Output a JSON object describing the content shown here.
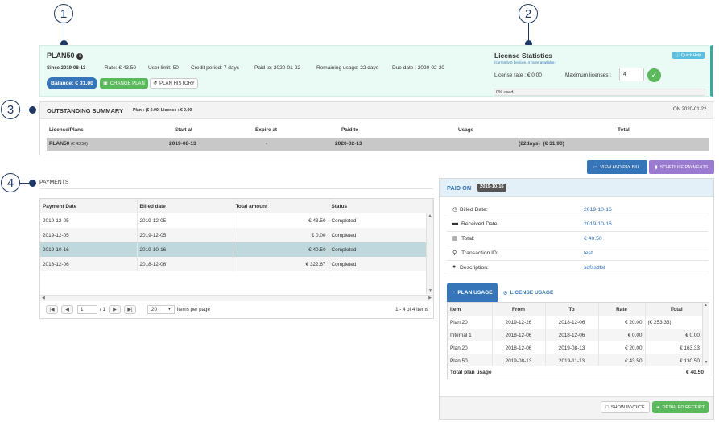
{
  "callouts": [
    "1",
    "2",
    "3",
    "4"
  ],
  "plan": {
    "name": "PLAN50",
    "since": "Since 2019-08-13",
    "rate": "Rate: € 43.50",
    "user_limit": "User limit: 50",
    "credit_period": "Credit period: 7 days",
    "paid_to": "Paid to: 2020-01-22",
    "remaining_usage": "Remaining usage: 22 days",
    "due_date": "Due date : 2020-02-20",
    "balance": "Balance: € 31.00",
    "change_plan": "CHANGE PLAN",
    "plan_history": "PLAN HISTORY"
  },
  "license": {
    "title": "License Statistics",
    "subtitle": "(currently 0 devices, 4 more available.)",
    "quick_help": "Quick Help",
    "rate": "License rate : € 0.00",
    "max_label": "Maximum licenses :",
    "max_value": "4",
    "used": "0% used"
  },
  "summary": {
    "title": "OUTSTANDING SUMMARY",
    "sub": "Plan : (€ 0.00)   License : € 0.00",
    "on": "ON 2020-01-22",
    "headers": [
      "License/Plans",
      "Start at",
      "Expire at",
      "Paid to",
      "Usage",
      "Total"
    ],
    "row": {
      "plan": "PLAN50",
      "plan_rate": "(€ 43.50)",
      "start": "2019-08-13",
      "expire": "-",
      "paid": "2020-02-13",
      "usage_days": "(22days)",
      "usage_amount": "(€ 31.90)"
    }
  },
  "actions": {
    "view_pay": "VIEW AND PAY BILL",
    "schedule": "SCHEDULE PAYMENTS"
  },
  "payments": {
    "title": "PAYMENTS",
    "headers": [
      "Payment Date",
      "Billed date",
      "Total amount",
      "Status"
    ],
    "rows": [
      [
        "2019-12-05",
        "2019-12-05",
        "€ 43.50",
        "Completed"
      ],
      [
        "2019-12-05",
        "2019-12-05",
        "€ 0.00",
        "Completed"
      ],
      [
        "2019-10-16",
        "2019-10-16",
        "€ 40.50",
        "Completed"
      ],
      [
        "2018-12-06",
        "2018-12-06",
        "€ 322.67",
        "Completed"
      ]
    ],
    "page": "1",
    "of_pages": "/ 1",
    "per_page": "20",
    "per_page_label": "items per page",
    "count": "1 - 4 of 4 items"
  },
  "paid_on": {
    "title": "PAID ON",
    "date": "2019-10-16",
    "fields": [
      {
        "label": "Billed Date:",
        "value": "2019-10-16",
        "icon": "clock-icon"
      },
      {
        "label": "Received Date:",
        "value": "2019-10-16",
        "icon": "card-icon"
      },
      {
        "label": "Total:",
        "value": "€ 40.50",
        "icon": "money-icon"
      },
      {
        "label": "Transaction ID:",
        "value": "test",
        "icon": "key-icon"
      },
      {
        "label": "Description:",
        "value": "sdfssdfsf",
        "icon": "comment-icon"
      }
    ],
    "tab_plan": "PLAN USAGE",
    "tab_license": "LICENSE USAGE",
    "usage_headers": [
      "Item",
      "From",
      "To",
      "Rate",
      "Total"
    ],
    "usage_rows": [
      [
        "Plan 20",
        "2019-12-26",
        "2018-12-06",
        "€ 20.00",
        "(€ 253.33)"
      ],
      [
        "Internal 1",
        "2018-12-06",
        "2018-12-06",
        "€ 0.00",
        "€ 0.00"
      ],
      [
        "Plan 20",
        "2018-12-06",
        "2019-08-13",
        "€ 20.00",
        "€ 163.33"
      ],
      [
        "Plan 50",
        "2019-08-13",
        "2019-11-13",
        "€ 43.50",
        "€ 130.50"
      ]
    ],
    "total_label": "Total plan usage",
    "total_value": "€ 40.50",
    "show_invoice": "SHOW INVOICE",
    "detailed_receipt": "DETAILED RECEIPT"
  },
  "colors": {
    "primary": "#3575b8",
    "green": "#5cb85c",
    "purple": "#9a7bd0",
    "teal": "#3aa9a0"
  }
}
